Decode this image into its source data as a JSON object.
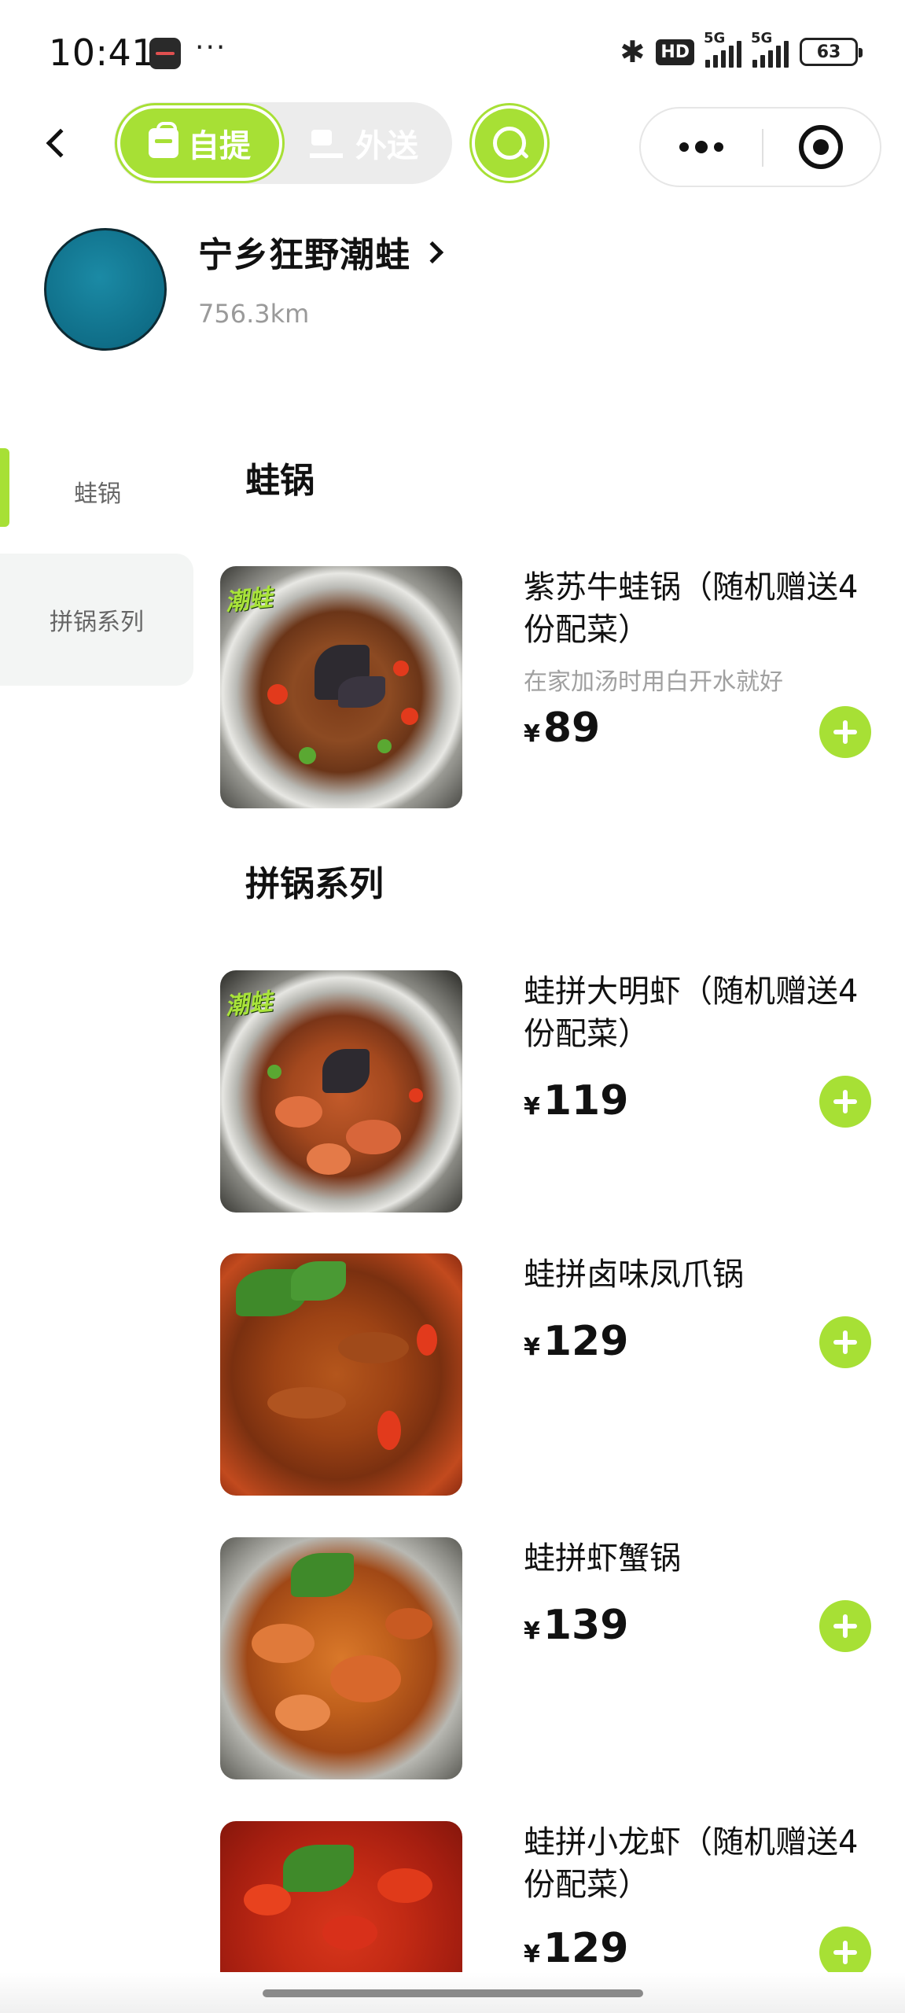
{
  "status_bar": {
    "time": "10:41",
    "more_glyph": "···",
    "bluetooth_glyph": "✱",
    "hd_badge": "HD",
    "network_1": "5G",
    "network_2": "5G",
    "battery": "63"
  },
  "nav": {
    "mode_pickup_label": "自提",
    "mode_delivery_label": "外送",
    "accent_color": "#a7e035"
  },
  "store": {
    "name": "宁乡狂野潮蛙",
    "distance": "756.3km"
  },
  "sidebar": {
    "items": [
      {
        "label": "蛙锅",
        "active": true
      },
      {
        "label": "拼锅系列",
        "active": false
      }
    ]
  },
  "categories": [
    {
      "title": "蛙锅",
      "items": [
        {
          "name": "紫苏牛蛙锅（随机赠送4份配菜）",
          "desc": "在家加汤时用白开水就好",
          "currency": "¥",
          "price": "89",
          "image": "frog-pot-photo"
        }
      ]
    },
    {
      "title": "拼锅系列",
      "items": [
        {
          "name": "蛙拼大明虾（随机赠送4份配菜）",
          "currency": "¥",
          "price": "119",
          "image": "frog-shrimp-pot-photo"
        },
        {
          "name": "蛙拼卤味凤爪锅",
          "currency": "¥",
          "price": "129",
          "image": "chicken-feet-pot-photo"
        },
        {
          "name": "蛙拼虾蟹锅",
          "currency": "¥",
          "price": "139",
          "image": "shrimp-crab-pot-photo"
        },
        {
          "name": "蛙拼小龙虾（随机赠送4份配菜）",
          "currency": "¥",
          "price": "129",
          "image": "crayfish-pot-photo"
        }
      ]
    }
  ],
  "food_logo_text": "潮蛙"
}
